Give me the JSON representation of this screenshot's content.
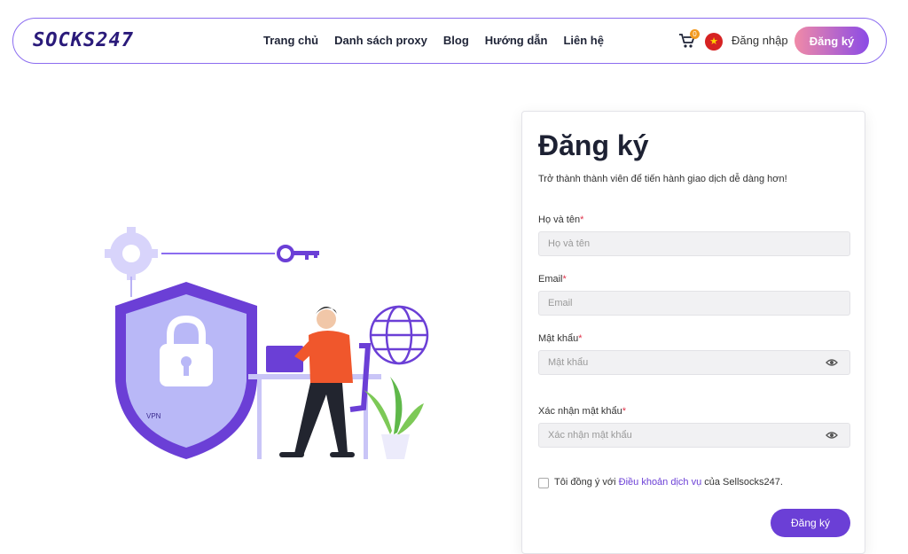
{
  "brand": {
    "logo_text": "SOCKS247"
  },
  "nav": {
    "items": [
      "Trang chủ",
      "Danh sách proxy",
      "Blog",
      "Hướng dẫn",
      "Liên hệ"
    ],
    "cart_count": "0",
    "login_label": "Đăng nhập",
    "signup_label": "Đăng ký"
  },
  "illustration": {
    "shield_label": "VPN"
  },
  "form": {
    "title": "Đăng ký",
    "subtitle": "Trở thành thành viên để tiến hành giao dịch dễ dàng hơn!",
    "fields": [
      {
        "label": "Họ và tên",
        "placeholder": "Họ và tên",
        "value": ""
      },
      {
        "label": "Email",
        "placeholder": "Email",
        "value": ""
      },
      {
        "label": "Mật khẩu",
        "placeholder": "Mật khẩu",
        "value": ""
      },
      {
        "label": "Xác nhận mật khẩu",
        "placeholder": "Xác nhận mật khẩu",
        "value": ""
      }
    ],
    "required_mark": "*",
    "terms": {
      "prefix": "Tôi đồng ý với ",
      "link": "Điều khoản dịch vụ",
      "suffix": " của Sellsocks247."
    },
    "submit_label": "Đăng ký"
  },
  "colors": {
    "primary": "#6b3fd6",
    "nav_border": "#8b6cf0",
    "required": "#e0344b"
  }
}
